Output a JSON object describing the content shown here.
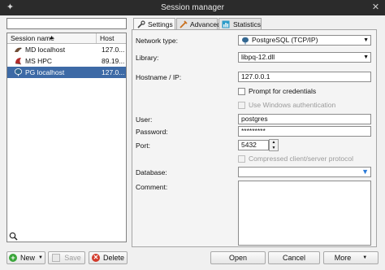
{
  "window": {
    "title": "Session manager"
  },
  "filter": {
    "value": ""
  },
  "sessions": {
    "columns": [
      "Session name",
      "Host"
    ],
    "rows": [
      {
        "name": "MD localhost",
        "host": "127.0...",
        "icon": "mariadb-icon",
        "selected": false
      },
      {
        "name": "MS HPC",
        "host": "89.19...",
        "icon": "mssql-icon",
        "selected": false
      },
      {
        "name": "PG localhost",
        "host": "127.0...",
        "icon": "postgresql-icon",
        "selected": true
      }
    ]
  },
  "buttons": {
    "new": "New",
    "save": "Save",
    "delete": "Delete",
    "open": "Open",
    "cancel": "Cancel",
    "more": "More"
  },
  "tabs": [
    {
      "label": "Settings",
      "icon": "wrench-icon",
      "active": true
    },
    {
      "label": "Advanced",
      "icon": "tools-icon",
      "active": false
    },
    {
      "label": "Statistics",
      "icon": "chart-icon",
      "active": false
    }
  ],
  "settings": {
    "network_type": {
      "label": "Network type:",
      "value": "PostgreSQL (TCP/IP)"
    },
    "library": {
      "label": "Library:",
      "value": "libpq-12.dll"
    },
    "hostname": {
      "label": "Hostname / IP:",
      "value": "127.0.0.1"
    },
    "prompt_credentials": {
      "label": "Prompt for credentials",
      "checked": false,
      "enabled": true
    },
    "windows_auth": {
      "label": "Use Windows authentication",
      "checked": false,
      "enabled": false
    },
    "user": {
      "label": "User:",
      "value": "postgres"
    },
    "password": {
      "label": "Password:",
      "value": "*********"
    },
    "port": {
      "label": "Port:",
      "value": "5432"
    },
    "compressed": {
      "label": "Compressed client/server protocol",
      "checked": false,
      "enabled": false
    },
    "database": {
      "label": "Database:",
      "value": ""
    },
    "comment": {
      "label": "Comment:",
      "value": ""
    }
  },
  "colors": {
    "titlebar": "#2b2b2b",
    "selection": "#3d6aa6",
    "accent_arrow": "#2a7ad8"
  }
}
